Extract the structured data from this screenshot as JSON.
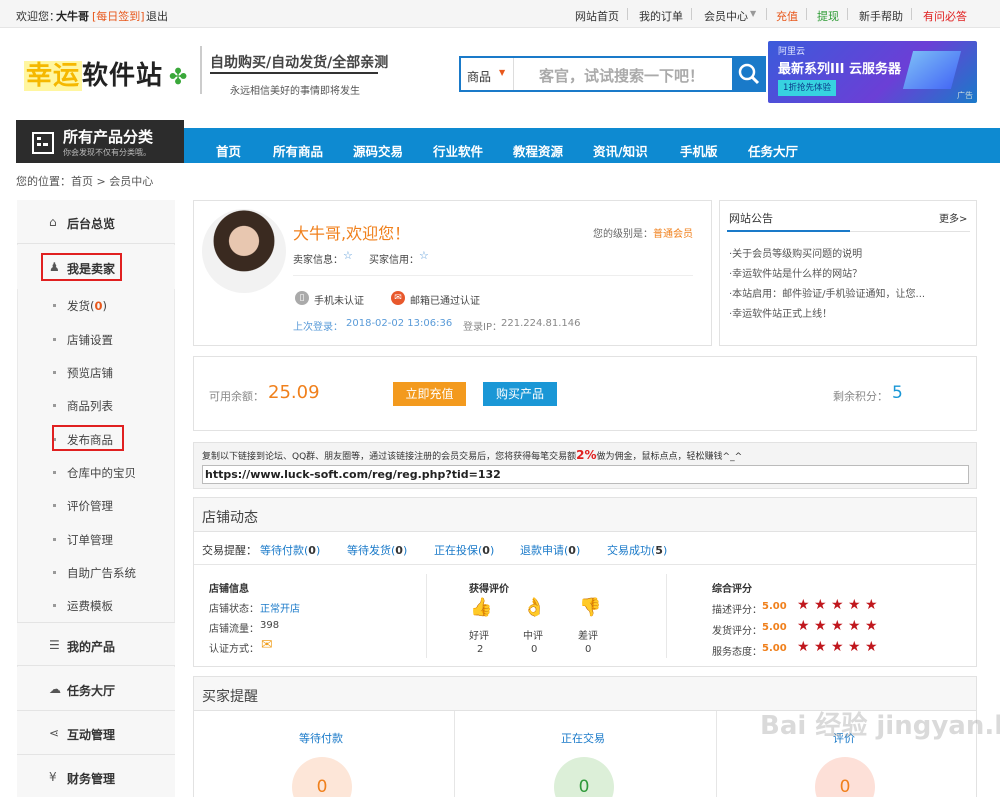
{
  "topbar": {
    "welcome": "欢迎您：",
    "username": "大牛哥",
    "checkin": "[每日签到]",
    "logout": "退出",
    "links": [
      "网站首页",
      "我的订单",
      "会员中心",
      "充值",
      "提现",
      "新手帮助",
      "有问必答"
    ]
  },
  "header": {
    "logo_a": "幸运",
    "logo_b": "软件站",
    "slogan": "自助购买/自动发货/全部亲测",
    "slogan_sub": "永远相信美好的事情即将发生",
    "search_category": "商品",
    "search_placeholder": "客官，试试搜索一下吧！",
    "ad_brand": "阿里云",
    "ad_title": "最新系列III 云服务器",
    "ad_button": "1折抢先体验",
    "ad_tag": "广告"
  },
  "nav": {
    "category_title": "所有产品分类",
    "category_sub": "你会发现不仅有分类哦。",
    "items": [
      "首页",
      "所有商品",
      "源码交易",
      "行业软件",
      "教程资源",
      "资讯/知识",
      "手机版",
      "任务大厅"
    ]
  },
  "breadcrumb": "您的位置：首页 > 会员中心",
  "sidebar": {
    "overview": "后台总览",
    "seller": "我是卖家",
    "seller_items": [
      "发货",
      "店铺设置",
      "预览店铺",
      "商品列表",
      "发布商品",
      "仓库中的宝贝",
      "评价管理",
      "订单管理",
      "自助广告系统",
      "运费模板"
    ],
    "ship_count": "0",
    "my_products": "我的产品",
    "task_hall": "任务大厅",
    "interaction": "互动管理",
    "finance": "财务管理"
  },
  "profile": {
    "greeting": "大牛哥,欢迎您！",
    "level_label": "您的级别是：",
    "level": "普通会员",
    "seller_info": "卖家信息：",
    "buyer_credit": "买家信用：",
    "phone_status": "手机未认证",
    "email_status": "邮箱已通过认证",
    "last_login_label": "上次登录：",
    "last_login": "2018-02-02 13:06:36",
    "login_ip_label": "登录IP：",
    "login_ip": "221.224.81.146"
  },
  "notice": {
    "title": "网站公告",
    "more": "更多>",
    "items": [
      "·关于会员等级购买问题的说明",
      "·幸运软件站是什么样的网站？",
      "·本站启用：邮件验证/手机验证通知，让您...",
      "·幸运软件站正式上线！"
    ]
  },
  "balance": {
    "label": "可用余额：",
    "amount": "25.09",
    "recharge": "立即充值",
    "buy": "购买产品",
    "points_label": "剩余积分：",
    "points": "5"
  },
  "referral": {
    "text": "复制以下链接到论坛、QQ群、朋友圈等，通过该链接注册的会员交易后，您将获得每笔交易额",
    "percent": "2%",
    "text2": "做为佣金，鼠标点点，轻松赚钱^_^",
    "link": "https://www.luck-soft.com/reg/reg.php?tid=132"
  },
  "shop": {
    "title": "店铺动态",
    "trade_label": "交易提醒：",
    "trades": [
      {
        "label": "等待付款",
        "count": "0"
      },
      {
        "label": "等待发货",
        "count": "0"
      },
      {
        "label": "正在投保",
        "count": "0"
      },
      {
        "label": "退款申请",
        "count": "0"
      },
      {
        "label": "交易成功",
        "count": "5"
      }
    ],
    "info_title": "店铺信息",
    "status_label": "店铺状态：",
    "status": "正常开店",
    "traffic_label": "店铺流量：",
    "traffic": "398",
    "auth_label": "认证方式：",
    "rating_title": "获得评价",
    "ratings": [
      {
        "label": "好评",
        "count": "2"
      },
      {
        "label": "中评",
        "count": "0"
      },
      {
        "label": "差评",
        "count": "0"
      }
    ],
    "score_title": "综合评分",
    "scores": [
      {
        "label": "描述评分：",
        "value": "5.00"
      },
      {
        "label": "发货评分：",
        "value": "5.00"
      },
      {
        "label": "服务态度：",
        "value": "5.00"
      }
    ]
  },
  "buyer": {
    "title": "买家提醒",
    "cols": [
      {
        "label": "等待付款",
        "count": "0"
      },
      {
        "label": "正在交易",
        "count": "0"
      },
      {
        "label": "评价",
        "count": "0"
      }
    ]
  },
  "watermark": "Bai 经验 jingyan.baidu.com"
}
